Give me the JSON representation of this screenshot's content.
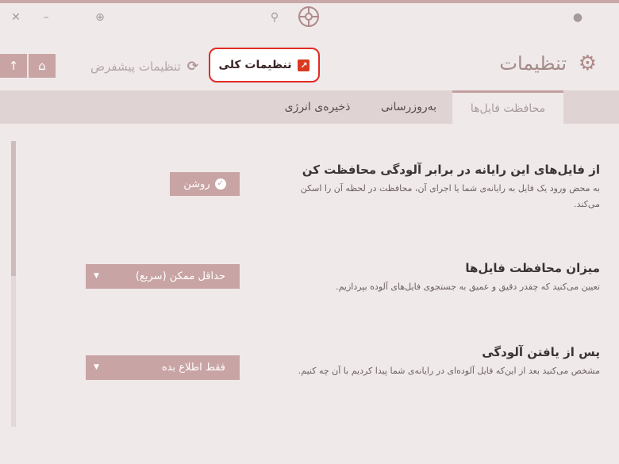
{
  "titlebar": {
    "close_icon": "✕",
    "min_icon": "–",
    "globe_icon": "⊕",
    "search_icon": "⚲",
    "user_icon": "●"
  },
  "header": {
    "title": "تنظیمات",
    "general_settings_label": "تنظیمات کلی",
    "advanced_settings_label": "تنظیمات پیشفرض",
    "refresh_icon": "⟳",
    "external_icon": "↗",
    "gear_icon": "⚙",
    "home_icon": "⌂",
    "up_icon": "↑"
  },
  "tabs": [
    {
      "label": "محافظت فایل‌ها",
      "active": true
    },
    {
      "label": "به‌روزرسانی",
      "active": false
    },
    {
      "label": "ذخیره‌ی انرژی",
      "active": false
    }
  ],
  "sections": {
    "protect": {
      "title": "از فایل‌های این رایانه در برابر آلودگی محافظت کن",
      "desc": "به محض ورود یک فایل به رایانه‌ی شما یا اجرای آن، محافظت در لحظه آن را اسکن می‌کند.",
      "toggle_label": "روشن",
      "toggle_icon": "✓"
    },
    "level": {
      "title": "میزان محافظت فایل‌ها",
      "desc": "تعیین می‌کنید که چقدر دقیق و عمیق به جستجوی فایل‌های آلوده بپردازیم.",
      "value": "حداقل ممکن (سریع)",
      "caret": "▼"
    },
    "after": {
      "title": "پس از یافتن آلودگی",
      "desc": "مشخص می‌کنید بعد از این‌که فایل آلوده‌ای در رایانه‌ی شما پیدا کردیم با آن چه کنیم.",
      "value": "فقط اطلاع بده",
      "caret": "▼"
    }
  },
  "colors": {
    "accent": "#c9a4a4",
    "highlight_border": "#e02b24",
    "background": "#efe9e9",
    "tab_bar": "#dfd3d3"
  }
}
